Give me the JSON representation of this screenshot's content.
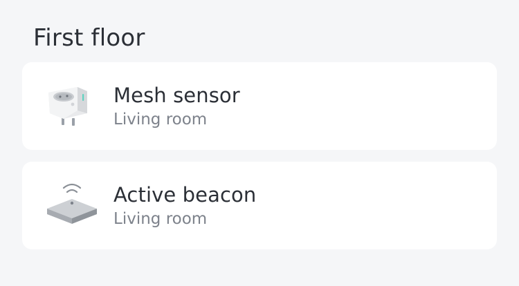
{
  "section": {
    "title": "First floor"
  },
  "devices": [
    {
      "name": "Mesh sensor",
      "room": "Living room",
      "icon": "smart-plug-icon"
    },
    {
      "name": "Active beacon",
      "room": "Living room",
      "icon": "beacon-hub-icon"
    }
  ],
  "colors": {
    "background": "#f5f6f8",
    "card": "#ffffff",
    "title_text": "#2b2f36",
    "secondary_text": "#7d828b",
    "led_accent": "#5fd3c0"
  }
}
